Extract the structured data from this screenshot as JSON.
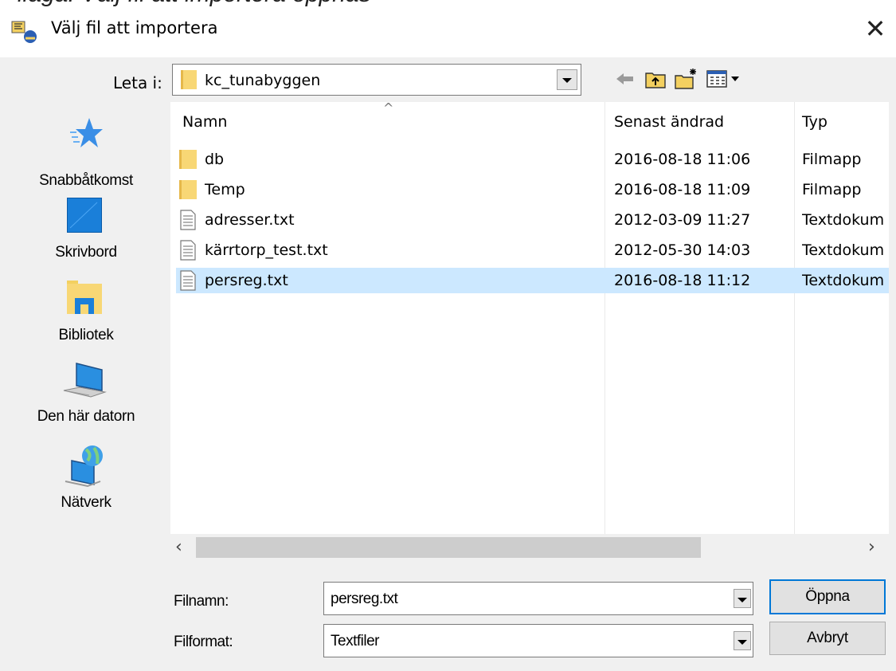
{
  "caption": {
    "text": "ilaga: Välj fil att importera oppnas"
  },
  "window": {
    "title": "Välj fil att importera",
    "close_glyph": "✕"
  },
  "lookin": {
    "label": "Leta i:",
    "value": "kc_tunabyggen"
  },
  "toolbar": {
    "icons": [
      "back-arrow-icon",
      "up-one-level-icon",
      "new-folder-icon",
      "view-menu-icon"
    ]
  },
  "places": [
    {
      "label": "Snabbåtkomst",
      "icon": "star-icon"
    },
    {
      "label": "Skrivbord",
      "icon": "desktop-icon"
    },
    {
      "label": "Bibliotek",
      "icon": "library-icon"
    },
    {
      "label": "Den här datorn",
      "icon": "computer-icon"
    },
    {
      "label": "Nätverk",
      "icon": "network-icon"
    }
  ],
  "columns": {
    "name": "Namn",
    "date": "Senast ändrad",
    "type": "Typ"
  },
  "files": [
    {
      "name": "db",
      "date": "2016-08-18 11:06",
      "type": "Filmapp",
      "kind": "folder"
    },
    {
      "name": "Temp",
      "date": "2016-08-18 11:09",
      "type": "Filmapp",
      "kind": "folder"
    },
    {
      "name": "adresser.txt",
      "date": "2012-03-09 11:27",
      "type": "Textdokument",
      "kind": "text"
    },
    {
      "name": "kärrtorp_test.txt",
      "date": "2012-05-30 14:03",
      "type": "Textdokument",
      "kind": "text"
    },
    {
      "name": "persreg.txt",
      "date": "2016-08-18 11:12",
      "type": "Textdokument",
      "kind": "text",
      "selected": true
    }
  ],
  "filename": {
    "label": "Filnamn:",
    "value": "persreg.txt"
  },
  "fileformat": {
    "label": "Filformat:",
    "value": "Textfiler"
  },
  "buttons": {
    "open": "Öppna",
    "cancel": "Avbryt"
  },
  "colors": {
    "selection": "#cce8ff",
    "dialog_bg": "#f0f0f0",
    "focus": "#0078d7",
    "folder": "#f8d775"
  }
}
